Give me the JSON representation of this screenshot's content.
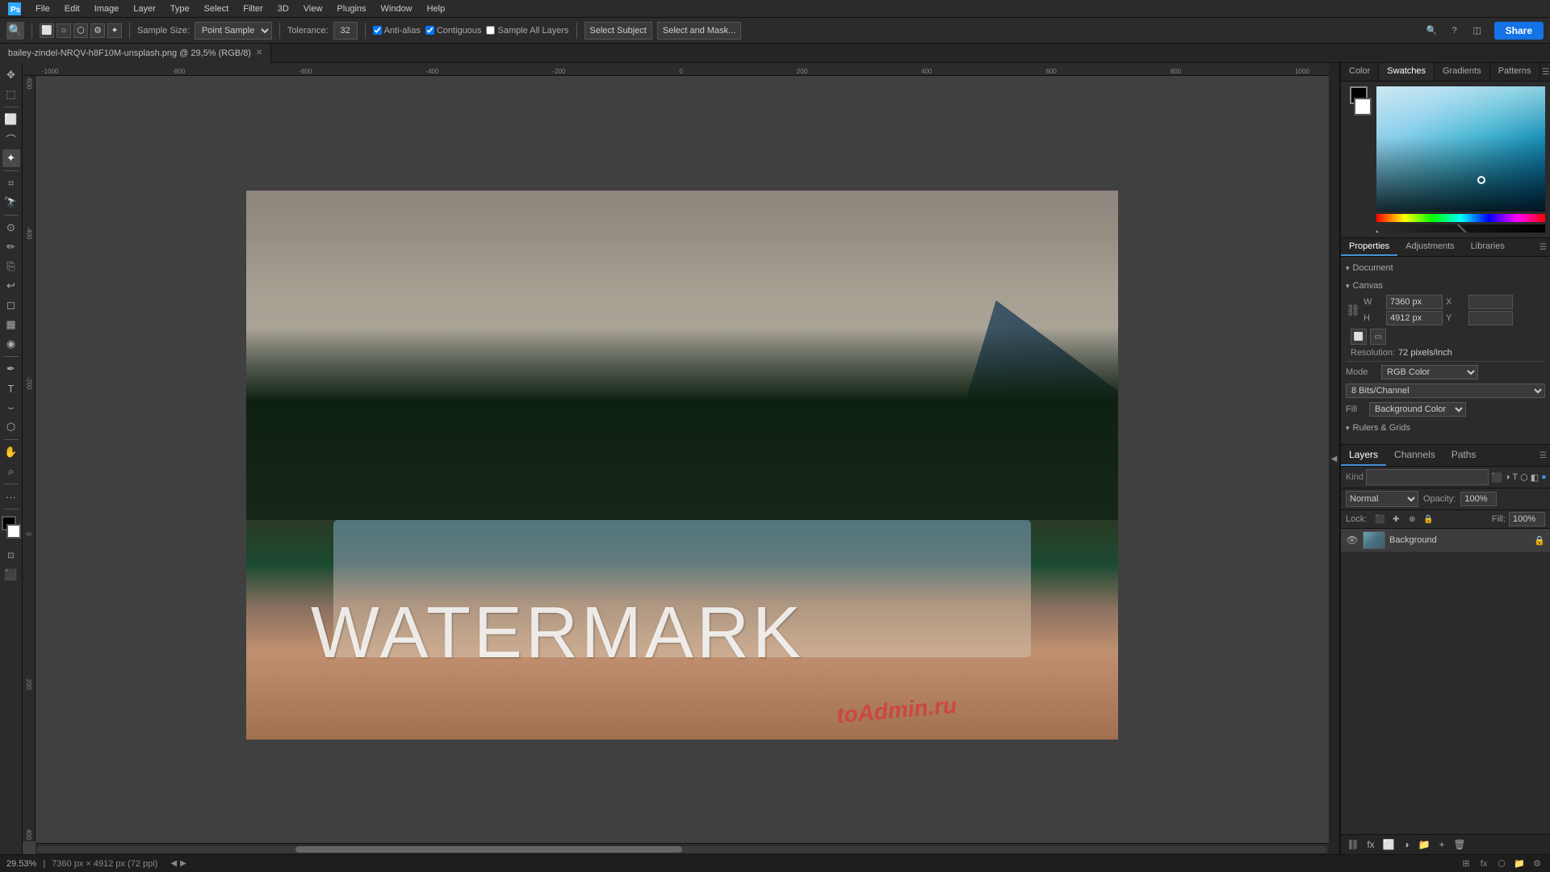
{
  "app": {
    "title": "Adobe Photoshop"
  },
  "menu": {
    "items": [
      "File",
      "Edit",
      "Image",
      "Layer",
      "Type",
      "Select",
      "Filter",
      "3D",
      "View",
      "Plugins",
      "Window",
      "Help"
    ]
  },
  "toolbar": {
    "tool_options": {
      "sample_size_label": "Sample Size:",
      "sample_size_value": "Point Sample",
      "tolerance_label": "Tolerance:",
      "tolerance_value": "32",
      "anti_alias_label": "Anti-alias",
      "contiguous_label": "Contiguous",
      "sample_all_label": "Sample All Layers",
      "select_subject_btn": "Select Subject",
      "select_mask_btn": "Select and Mask...",
      "share_btn": "Share"
    }
  },
  "document": {
    "tab_name": "bailey-zindel-NRQV-h8F10M-unsplash.png @ 29,5% (RGB/8)",
    "zoom": "29.53%",
    "dims": "7360 px × 4912 px (72 ppi)"
  },
  "color_panel": {
    "tabs": [
      "Color",
      "Swatches",
      "Gradients",
      "Patterns"
    ],
    "active_tab": "Swatches"
  },
  "properties_panel": {
    "tabs": [
      "Properties",
      "Adjustments",
      "Libraries"
    ],
    "active_tab": "Properties",
    "section_document": "Document",
    "section_canvas": "Canvas",
    "canvas": {
      "w_label": "W",
      "w_value": "7360 px",
      "h_label": "H",
      "h_value": "4912 px",
      "x_label": "X",
      "y_label": "Y",
      "resolution_label": "Resolution:",
      "resolution_value": "72 pixels/inch",
      "mode_label": "Mode",
      "mode_value": "RGB Color",
      "bit_depth_value": "8 Bits/Channel",
      "fill_label": "Fill",
      "fill_value": "Background Color"
    },
    "section_rulers": "Rulers & Grids"
  },
  "layers_panel": {
    "tabs": [
      "Layers",
      "Channels",
      "Paths"
    ],
    "active_tab": "Layers",
    "search_placeholder": "Kind",
    "mode": {
      "label": "Normal",
      "opacity_label": "Opacity:",
      "opacity_value": "100%",
      "fill_label": "Fill:",
      "fill_value": "100%"
    },
    "lock_label": "Lock:",
    "layers": [
      {
        "name": "Background",
        "visible": true,
        "locked": true
      }
    ]
  },
  "watermark": {
    "text": "WATERMARK",
    "overlay": "toAdmin.ru"
  },
  "status": {
    "zoom": "29.53%",
    "dims": "7360 px × 4912 px (72 ppi)"
  },
  "icons": {
    "move": "✥",
    "marquee": "⬚",
    "lasso": "⌒",
    "wand": "⊹",
    "crop": "⌗",
    "eyedropper": "✦",
    "spot_heal": "⊙",
    "brush": "✏",
    "stamp": "⎘",
    "eraser": "◻",
    "gradient": "▦",
    "dodge": "◉",
    "pen": "✒",
    "text": "T",
    "shape": "⬡",
    "hand": "✋",
    "zoom": "⌕",
    "more": "...",
    "fg_bg": "⬛",
    "quick": "⊡"
  }
}
